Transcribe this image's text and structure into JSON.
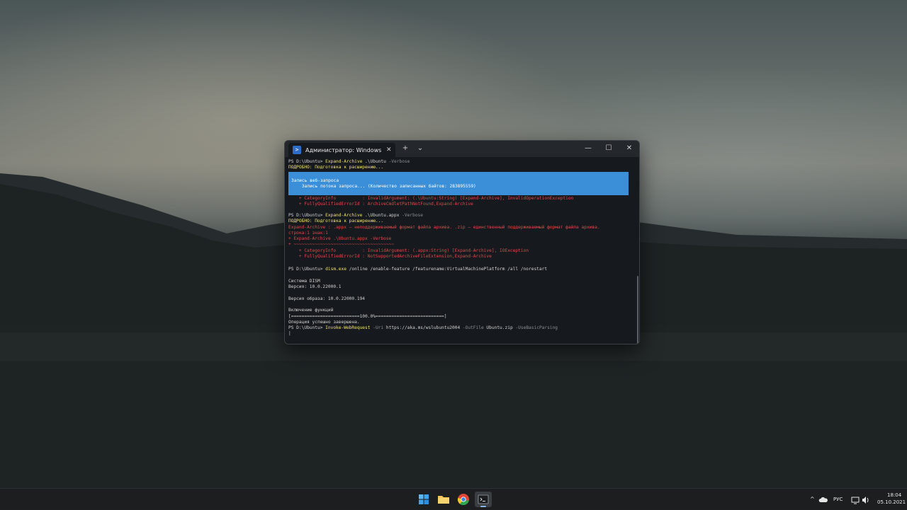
{
  "window": {
    "tab_title": "Администратор: Windows Pow",
    "tab_close": "✕",
    "new_tab": "+",
    "dropdown": "⌄",
    "minimize": "—",
    "maximize": "☐",
    "close": "✕"
  },
  "terminal": {
    "l1_prompt": "PS D:\\Ubuntu> ",
    "l1_cmd": "Expand-Archive",
    "l1_arg": " .\\Ubuntu",
    "l1_flag": " -Verbose",
    "l2": "ПОДРОБНО: Подготовка к расширению...",
    "progress_title": "Запись веб-запроса",
    "progress_status": "    Запись потока запроса... (Количество записанных байтов: 283895559)",
    "l3": "    + CategoryInfo          : InvalidArgument: (.\\Ubuntu:String) [Expand-Archive], InvalidOperationException",
    "l4": "    + FullyQualifiedErrorId : ArchiveCmdletPathNotFound,Expand-Archive",
    "l5_prompt": "PS D:\\Ubuntu> ",
    "l5_cmd": "Expand-Archive",
    "l5_arg": " .\\Ubuntu.appx",
    "l5_flag": " -Verbose",
    "l6": "ПОДРОБНО: Подготовка к расширению...",
    "l7": "Expand-Archive : .appx — неподдерживаемый формат файла архива. .zip — единственный поддерживаемый формат файла архива.",
    "l8": "строка:1 знак:1",
    "l9": "+ Expand-Archive .\\Ubuntu.appx -Verbose",
    "l10": "+ ~~~~~~~~~~~~~~~~~~~~~~~~~~~~~~~~~~~~~~",
    "l11": "    + CategoryInfo          : InvalidArgument: (.appx:String) [Expand-Archive], IOException",
    "l12": "    + FullyQualifiedErrorId : NotSupportedArchiveFileExtension,Expand-Archive",
    "l13_prompt": "PS D:\\Ubuntu> ",
    "l13_cmd": "dism.exe",
    "l13_arg": " /online /enable-feature /featurename:VirtualMachinePlatform /all /norestart",
    "l14": "Система DISM",
    "l15": "Версия: 10.0.22000.1",
    "l16": "Версия образа: 10.0.22000.194",
    "l17": "Включение функций",
    "l18": "[==========================100.0%==========================]",
    "l19": "Операция успешно завершена.",
    "l20_prompt": "PS D:\\Ubuntu> ",
    "l20_cmd": "Invoke-WebRequest",
    "l20_flag1": " -Uri",
    "l20_arg1": " https://aka.ms/wslubuntu2004",
    "l20_flag2": " -OutFile",
    "l20_arg2": " Ubuntu.zip",
    "l20_flag3": " -UseBasicParsing",
    "cursor": "|"
  },
  "taskbar": {
    "apps": [
      {
        "name": "start",
        "color": "#3c9be8"
      },
      {
        "name": "file-explorer",
        "color": "#f2c24b"
      },
      {
        "name": "chrome",
        "color": "#e04a3a"
      },
      {
        "name": "terminal",
        "color": "#2a2d30"
      }
    ],
    "tray": {
      "chevron": "^",
      "language": "РУС",
      "time": "18:04",
      "date": "05.10.2021"
    }
  }
}
